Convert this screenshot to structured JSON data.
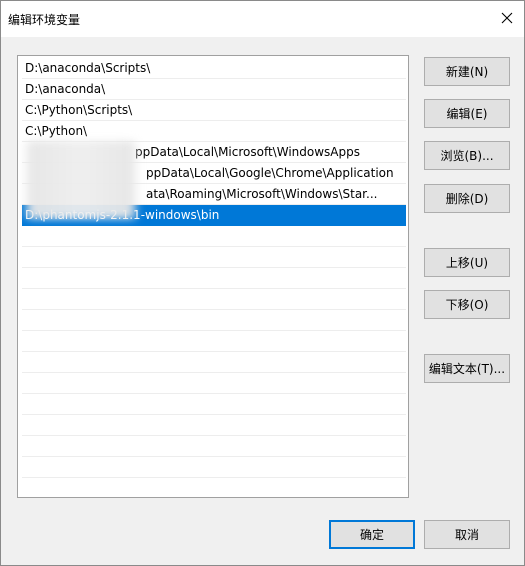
{
  "window": {
    "title": "编辑环境变量",
    "close_label": "×"
  },
  "list": {
    "items": [
      {
        "text": "D:\\anaconda\\Scripts\\"
      },
      {
        "text": "D:\\anaconda\\"
      },
      {
        "text": "C:\\Python\\Scripts\\"
      },
      {
        "text": "C:\\Python\\"
      },
      {
        "text": "ppData\\Local\\Microsoft\\WindowsApps"
      },
      {
        "text": "ppData\\Local\\Google\\Chrome\\Application"
      },
      {
        "text": "ata\\Roaming\\Microsoft\\Windows\\Star..."
      },
      {
        "text": "D:\\phantomjs-2.1.1-windows\\bin"
      }
    ],
    "selected_index": 7
  },
  "buttons": {
    "new": "新建(N)",
    "edit": "编辑(E)",
    "browse": "浏览(B)...",
    "delete": "删除(D)",
    "move_up": "上移(U)",
    "move_down": "下移(O)",
    "edit_text": "编辑文本(T)...",
    "ok": "确定",
    "cancel": "取消"
  },
  "colors": {
    "selection": "#0078d7",
    "primary_border": "#0078d7"
  }
}
